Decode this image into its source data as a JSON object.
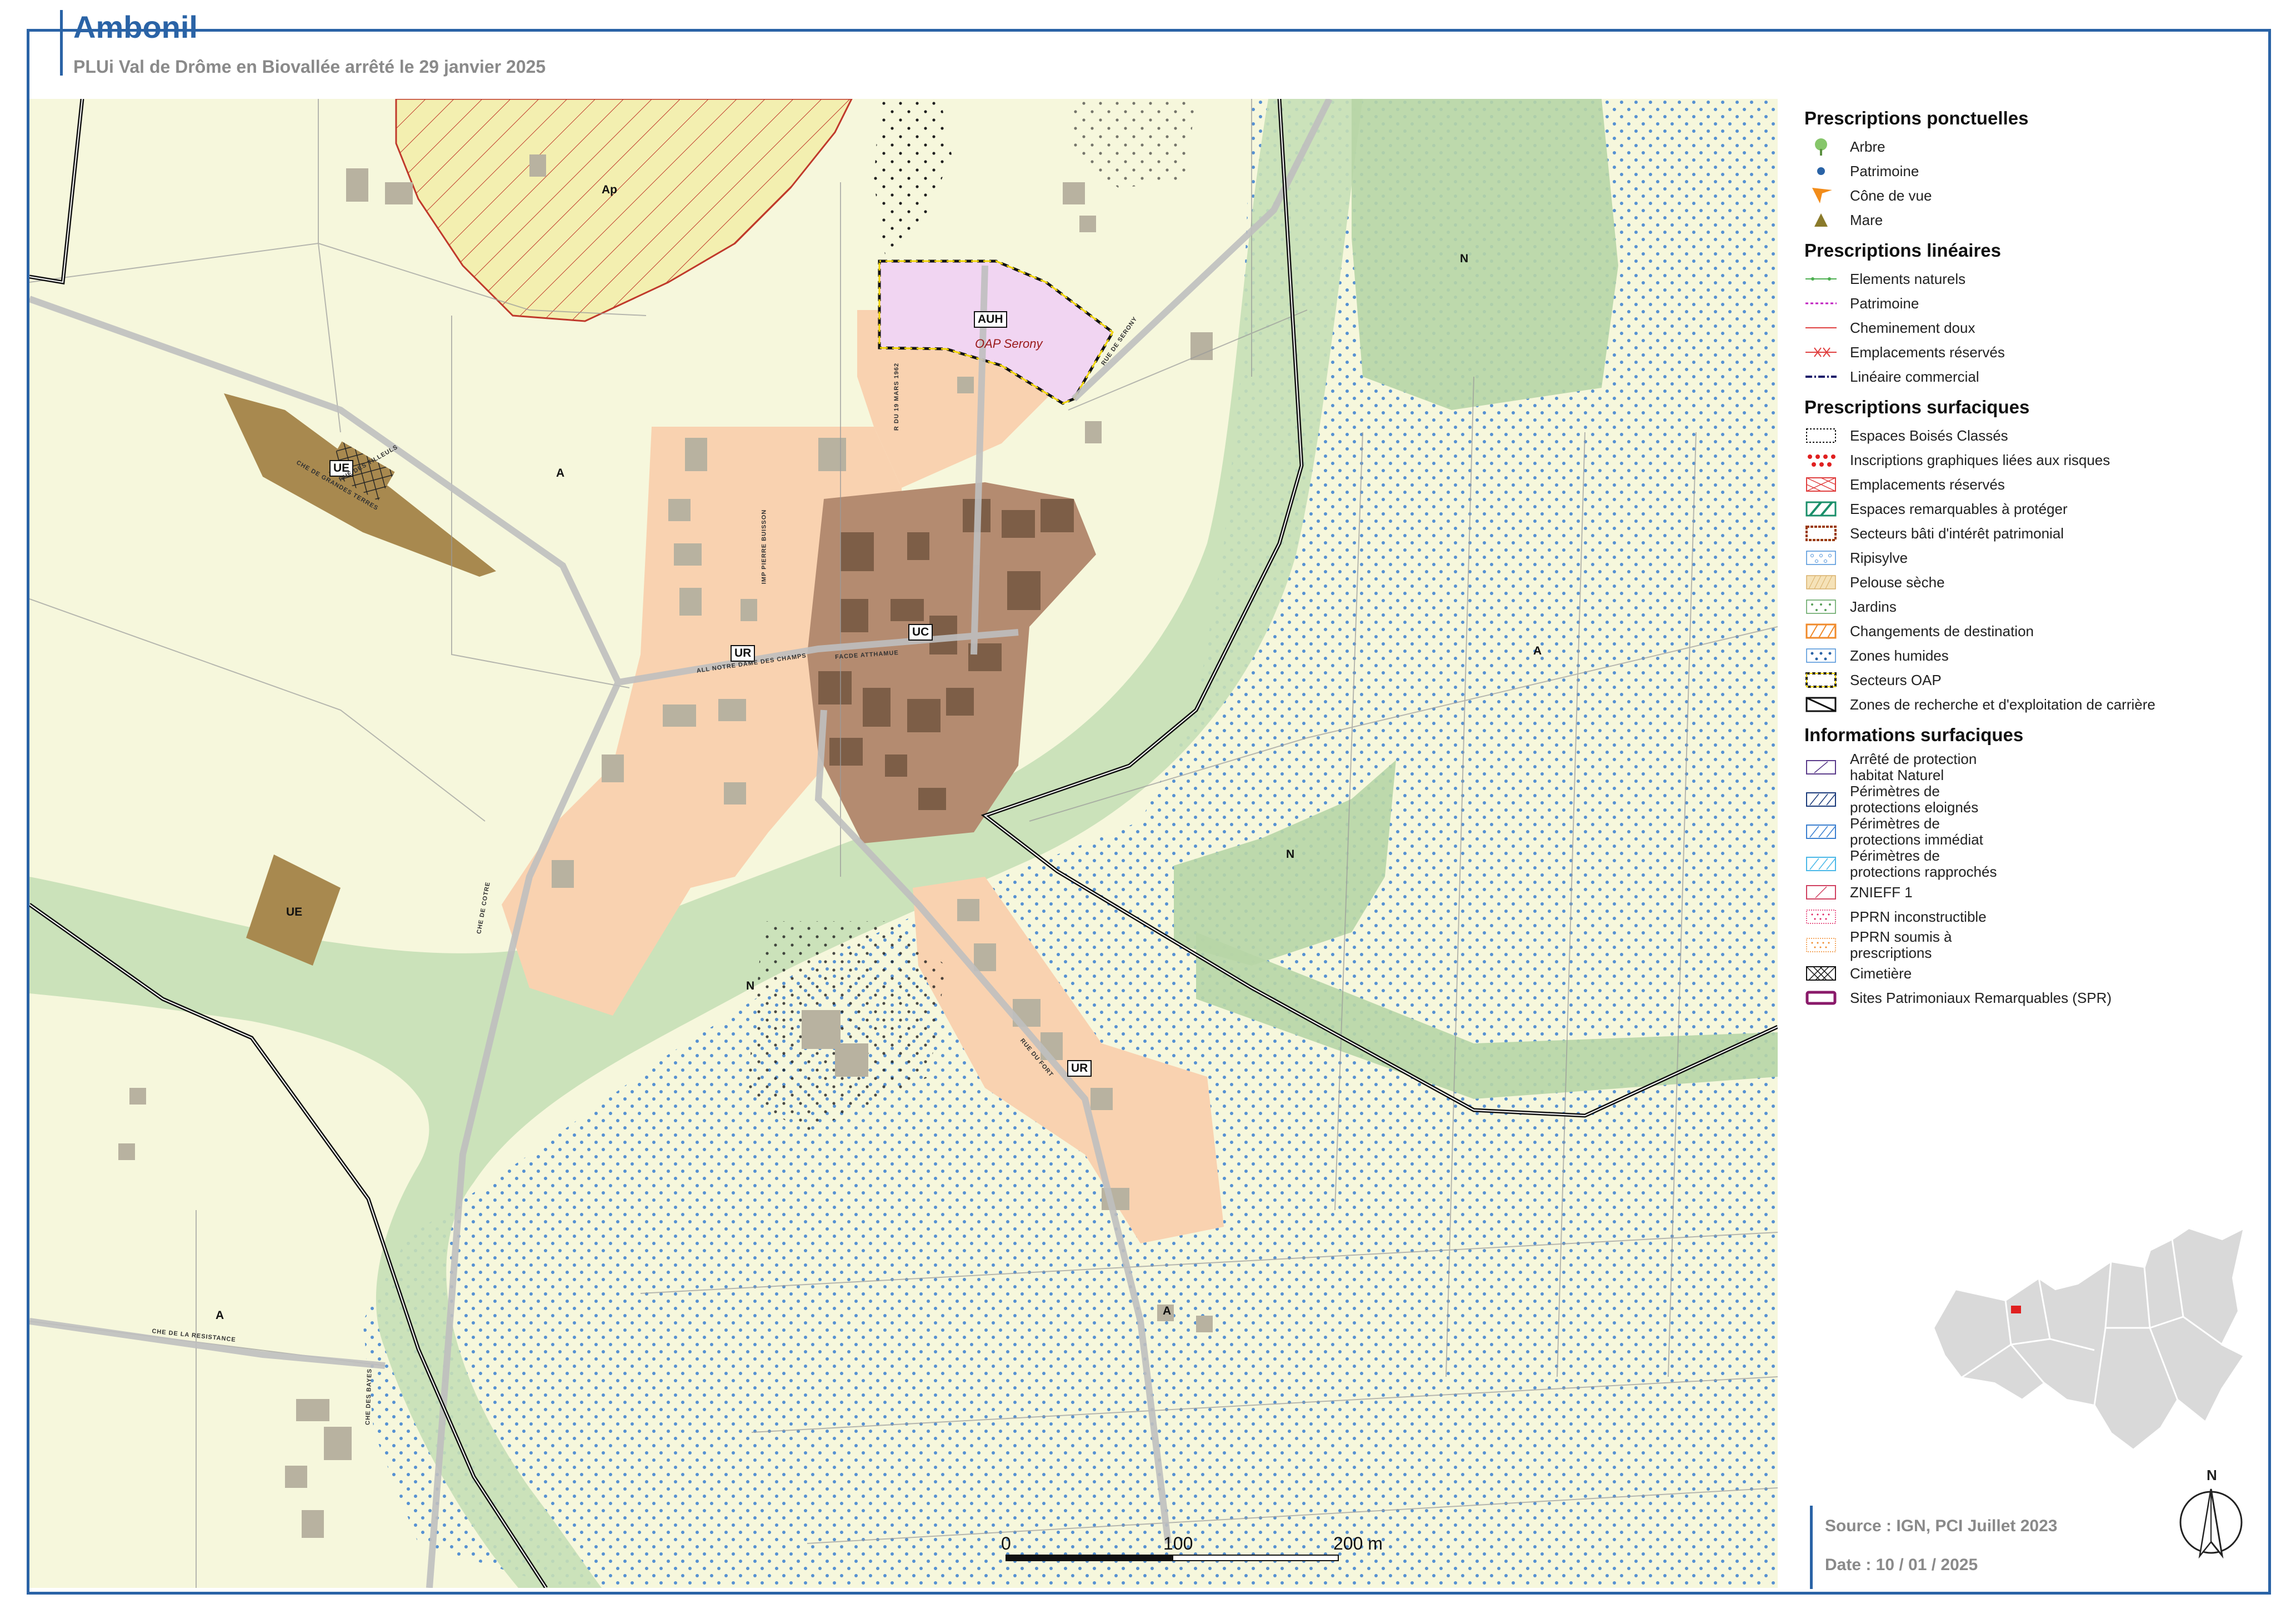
{
  "header": {
    "title": "Ambonil",
    "subtitle": "PLUi Val de Drôme en Biovallée arrêté le 29 janvier 2025"
  },
  "map": {
    "zones": [
      "Ap",
      "A",
      "UE",
      "UR",
      "UC",
      "AUH",
      "N",
      "A",
      "N",
      "UE",
      "N",
      "UR",
      "A",
      "A"
    ],
    "oap_label": "OAP Serony",
    "road_labels": [
      "RUE DES TILLEULS",
      "CHE DE GRANDES TERRES",
      "ALL NOTRE DAME DES CHAMPS",
      "FACDE ATTHAMUE",
      "RUE DU FORT",
      "CHE DE COTRE",
      "CHE DE LA RESISTANCE",
      "CHE DES BAYES",
      "R DU 19 MARS 1962",
      "RUE DE SERONY",
      "IMP PIERRE BUISSON"
    ],
    "colors": {
      "background": "#f6f7dc",
      "ap": "#f3efb0",
      "ur": "#f9d2b0",
      "uc": "#b48b70",
      "ue": "#a8894f",
      "auh": "#f1d5f2",
      "n_green": "#c7dfb6",
      "wet_dots": "#3a7fd0",
      "frame_blue": "#2a63a6"
    }
  },
  "scale": {
    "zero": "0",
    "mid": "100",
    "end": "200 m"
  },
  "legend": {
    "sections": [
      {
        "title": "Prescriptions ponctuelles",
        "items": [
          {
            "label": "Arbre",
            "icon": "tree-icon"
          },
          {
            "label": "Patrimoine",
            "icon": "dot-icon"
          },
          {
            "label": "Cône de vue",
            "icon": "view-cone-icon"
          },
          {
            "label": "Mare",
            "icon": "triangle-icon"
          }
        ]
      },
      {
        "title": "Prescriptions linéaires",
        "items": [
          {
            "label": "Elements naturels",
            "icon": "line-green-dots-icon"
          },
          {
            "label": "Patrimoine",
            "icon": "line-magenta-dash-icon"
          },
          {
            "label": "Cheminement doux",
            "icon": "line-red-icon"
          },
          {
            "label": "Emplacements réservés",
            "icon": "line-red-cross-icon"
          },
          {
            "label": "Linéaire commercial",
            "icon": "line-navy-dash-icon"
          }
        ]
      },
      {
        "title": "Prescriptions surfaciques",
        "items": [
          {
            "label": "Espaces Boisés Classés",
            "icon": "ebc-icon"
          },
          {
            "label": "Inscriptions graphiques liées aux risques",
            "icon": "risk-dots-icon"
          },
          {
            "label": "Emplacements réservés",
            "icon": "er-hatch-icon"
          },
          {
            "label": "Espaces remarquables à protéger",
            "icon": "green-hatch-icon"
          },
          {
            "label": "Secteurs bâti d'intérêt patrimonial",
            "icon": "heritage-box-icon"
          },
          {
            "label": "Ripisylve",
            "icon": "ripisylve-icon"
          },
          {
            "label": "Pelouse sèche",
            "icon": "pelouse-icon"
          },
          {
            "label": "Jardins",
            "icon": "jardins-icon"
          },
          {
            "label": "Changements de destination",
            "icon": "orange-hatch-icon"
          },
          {
            "label": "Zones humides",
            "icon": "blue-dots-icon"
          },
          {
            "label": "Secteurs OAP",
            "icon": "oap-box-icon"
          },
          {
            "label": "Zones de recherche et d'exploitation de carrière",
            "icon": "quarry-icon"
          }
        ]
      },
      {
        "title": "Informations surfaciques",
        "items": [
          {
            "label": "Arrêté de protection\nhabitat Naturel",
            "icon": "purple-hatch-icon"
          },
          {
            "label": "Périmètres de\nprotections eloignés",
            "icon": "navy-hatch-icon"
          },
          {
            "label": "Périmètres de\nprotections immédiat",
            "icon": "blue-hatch-icon"
          },
          {
            "label": "Périmètres de\nprotections rapprochés",
            "icon": "cyan-hatch-icon"
          },
          {
            "label": "ZNIEFF 1",
            "icon": "znieff-icon"
          },
          {
            "label": "PPRN inconstructible",
            "icon": "pprn-red-icon"
          },
          {
            "label": "PPRN soumis à\nprescriptions",
            "icon": "pprn-orange-icon"
          },
          {
            "label": "Cimetière",
            "icon": "cemetery-icon"
          },
          {
            "label": "Sites Patrimoniaux Remarquables (SPR)",
            "icon": "spr-icon"
          }
        ]
      }
    ]
  },
  "footer": {
    "source": "Source : IGN, PCI Juillet 2023",
    "date": "Date : 10 / 01 / 2025",
    "north": "N"
  }
}
